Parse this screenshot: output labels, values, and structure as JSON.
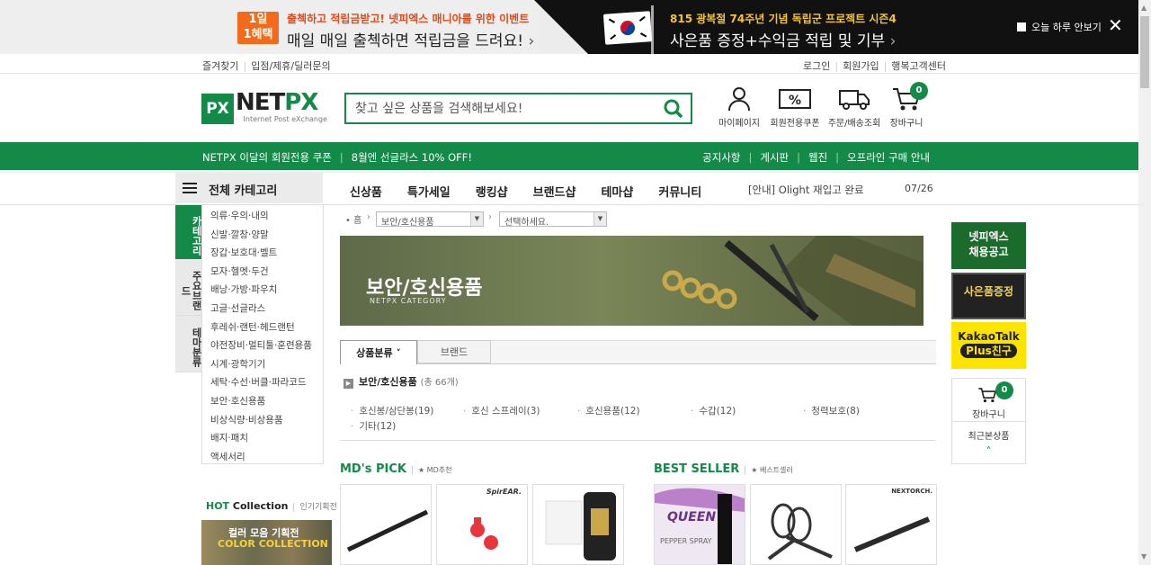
{
  "banner": {
    "left": {
      "badge": "1일\n1혜택",
      "line1": "출첵하고 적립금받고! 넷피엑스 매니아를 위한 이벤트",
      "line2": "매일 매일 출첵하면 적립금을 드려요!",
      "arrow": "›"
    },
    "right": {
      "line1": "815 광복절 74주년 기념 독립군 프로젝트 시즌4",
      "line2": "사은품 증정+수익금 적립 및 기부",
      "arrow": "›"
    },
    "today_label": "오늘 하루 안보기",
    "close": "✕"
  },
  "util": {
    "left": [
      "즐겨찾기",
      "입점/제휴/딜러문의"
    ],
    "right": [
      "로그인",
      "회원가입",
      "행복고객센터"
    ]
  },
  "logo": {
    "px": "PX",
    "name_a": "NET",
    "name_b": "PX",
    "sub": "Internet Post eXchange"
  },
  "search": {
    "placeholder": "찾고 싶은 상품을 검색해보세요!"
  },
  "header_icons": {
    "mypage": "마이페이지",
    "coupon": "회원전용쿠폰",
    "order": "주문/배송조회",
    "cart": "장바구니",
    "cart_count": "0"
  },
  "gnb": {
    "left": [
      "NETPX 이달의 회원전용 쿠폰",
      "8월엔 선글라스 10% OFF!"
    ],
    "right": [
      "공지사항",
      "게시판",
      "웹진",
      "오프라인 구매 안내"
    ]
  },
  "menu": {
    "all": "전체 카테고리",
    "items": [
      "신상품",
      "특가세일",
      "랭킹샵",
      "브랜드샵",
      "테마샵",
      "커뮤니티"
    ],
    "notice": "[안내] Olight 재입고 완료",
    "notice_date": "07/26"
  },
  "vtabs": [
    "카테고리",
    "주요브랜드",
    "테마분류"
  ],
  "categories": [
    "의류·우의·내의",
    "신발·깔창·양말",
    "장갑·보호대·벨트",
    "모자·헬멧·두건",
    "배낭·가방·파우치",
    "고글·선글라스",
    "후레쉬·랜턴·헤드랜턴",
    "야전장비·멀티툴·훈련용품",
    "시계·광학기기",
    "세탁·수선·버클·파라코드",
    "보안·호신용품",
    "비상식량·비상용품",
    "배지·패치",
    "액세서리"
  ],
  "hot": {
    "a": "HOT",
    "b": " Collection",
    "c": "인기기획전",
    "img1": "컬러 모음 기획전",
    "img2": "COLOR COLLECTION"
  },
  "breadcrumb": {
    "home": "• 홈",
    "sel1": "보안/호신용품",
    "sel2": "선택하세요.",
    "arrow": "›",
    "dd": "▼"
  },
  "hero": {
    "title": "보안/호신용품",
    "sub": "NETPX CATEGORY"
  },
  "tabs": {
    "t1": "상품분류 ˅",
    "t2": "브랜드"
  },
  "cat_head": {
    "name": "보안/호신용품",
    "count": "(총 66개)",
    "arr": "▶"
  },
  "subcats": [
    "호신봉/삼단봉(19)",
    "호신 스프레이(3)",
    "호신용품(12)",
    "수갑(12)",
    "청력보호(8)",
    "기타(12)"
  ],
  "sections": {
    "md": "MD's PICK",
    "md_sub": "★ MD추천",
    "best": "BEST SELLER",
    "best_sub": "★ 베스트셀러"
  },
  "products": {
    "brand2": "SpirEAR.",
    "brand5": "QUEEN",
    "brand5b": "PEPPER SPRAY",
    "brand7": "NEXTORCH."
  },
  "right": {
    "b1": "넷피엑스\n채용공고",
    "b2": "사은품증정",
    "b3a": "KakaoTalk",
    "b3b": "Plus친구",
    "cart": "장바구니",
    "cart_count": "0",
    "recent": "최근본상품",
    "up": "˄"
  },
  "colors": {
    "brand_green": "#138a48",
    "banner_dark": "#111111",
    "banner_light": "#eeeeee"
  }
}
